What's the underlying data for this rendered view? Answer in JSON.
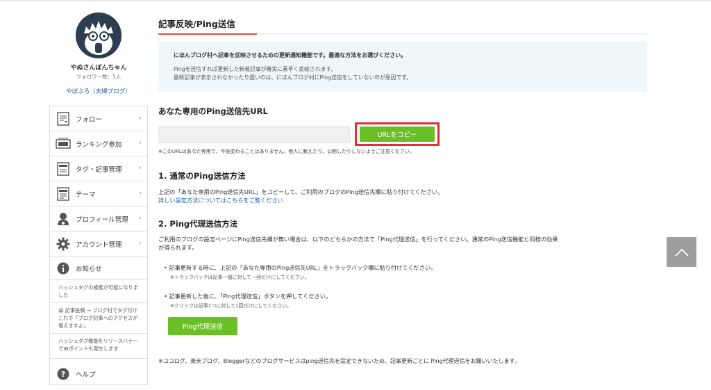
{
  "profile": {
    "username": "やぬさんぼんちゃん",
    "followers": "フォロワー数：5人",
    "blog_link": "やぼぶろ（夫婦ブログ）"
  },
  "sidebar": {
    "items": [
      {
        "label": "フォロー",
        "icon": "reader-icon"
      },
      {
        "label": "ランキング参加",
        "icon": "banner-icon"
      },
      {
        "label": "タグ・記事管理",
        "icon": "post-icon"
      },
      {
        "label": "テーマ",
        "icon": "theme-icon"
      },
      {
        "label": "プロフィール管理",
        "icon": "profile-icon"
      },
      {
        "label": "アカウント管理",
        "icon": "gear-icon"
      }
    ],
    "news_title": "お知らせ",
    "news": [
      "ハッシュタグの検索が可能になりました",
      "😀 記事投稿 → ブログ村でタグ付け　これで「ブログ記事へのアクセスが増えますよ」",
      "ハッシュタグ機能をリリースバナーでINポイントも発生します"
    ],
    "help_label": "ヘルプ",
    "chevron": "›"
  },
  "main": {
    "title": "記事反映/Ping送信",
    "info_lead": "にほんブログ村へ記事を反映させるための更新通知機能です。最適な方法をお選びください。",
    "info_line1": "Pingを送信すれば更新した新着記事が確実に素早く反映されます。",
    "info_line2": "最新記事が表示されなかったり遅いのは、にほんブログ村にPing送信をしていないのが原因です。",
    "url_section_title": "あなた専用のPing送信先URL",
    "url_value": "",
    "copy_button": "URLをコピー",
    "url_note": "※このURLはあなた専用で、今後変わることはありません。他人に教えたり、公開したりしないようご注意ください。",
    "section1_title": "1. 通常のPing送信方法",
    "section1_text": "上記の「あなた専用のPing送信先URL」をコピーして、ご利用のブログのPing送信先欄に貼り付けてください。",
    "section1_link": "詳しい設定方法についてはこちらをご覧ください",
    "section2_title": "2. Ping代理送信方法",
    "section2_text1": "ご利用のブログの設定ページにPing送信先欄が無い場合は、以下のどちらかの方法で「Ping代理送信」を行ってください。通常のPing送信機能と同様の効果",
    "section2_text2": "が得られます。",
    "bullet1": "• 記事更新する時に、上記の「あなた専用のPing送信先URL」をトラックバック欄に貼り付けてください。",
    "bullet1_note": "※トラックバックは記事一個に対して一回だけにしてください。",
    "bullet2": "• 記事更新した後に、「Ping代理送信」ボタンを押してください。",
    "bullet2_note": "※クリックは記事1つに対して1回だけにしてください。",
    "ping_button": "Ping代理送信",
    "footer_note": "※ココログ、楽天ブログ、Bloggerなどのブログサービスはping送信先を設定できないため、記事更新ごとに Ping代理送信をお願いいたします。"
  },
  "colors": {
    "accent_green": "#6bbf26",
    "highlight_red": "#e62d36",
    "link_blue": "#1a5fa8",
    "avatar_bg": "#2d3e50",
    "info_bg": "#eef7fa"
  }
}
